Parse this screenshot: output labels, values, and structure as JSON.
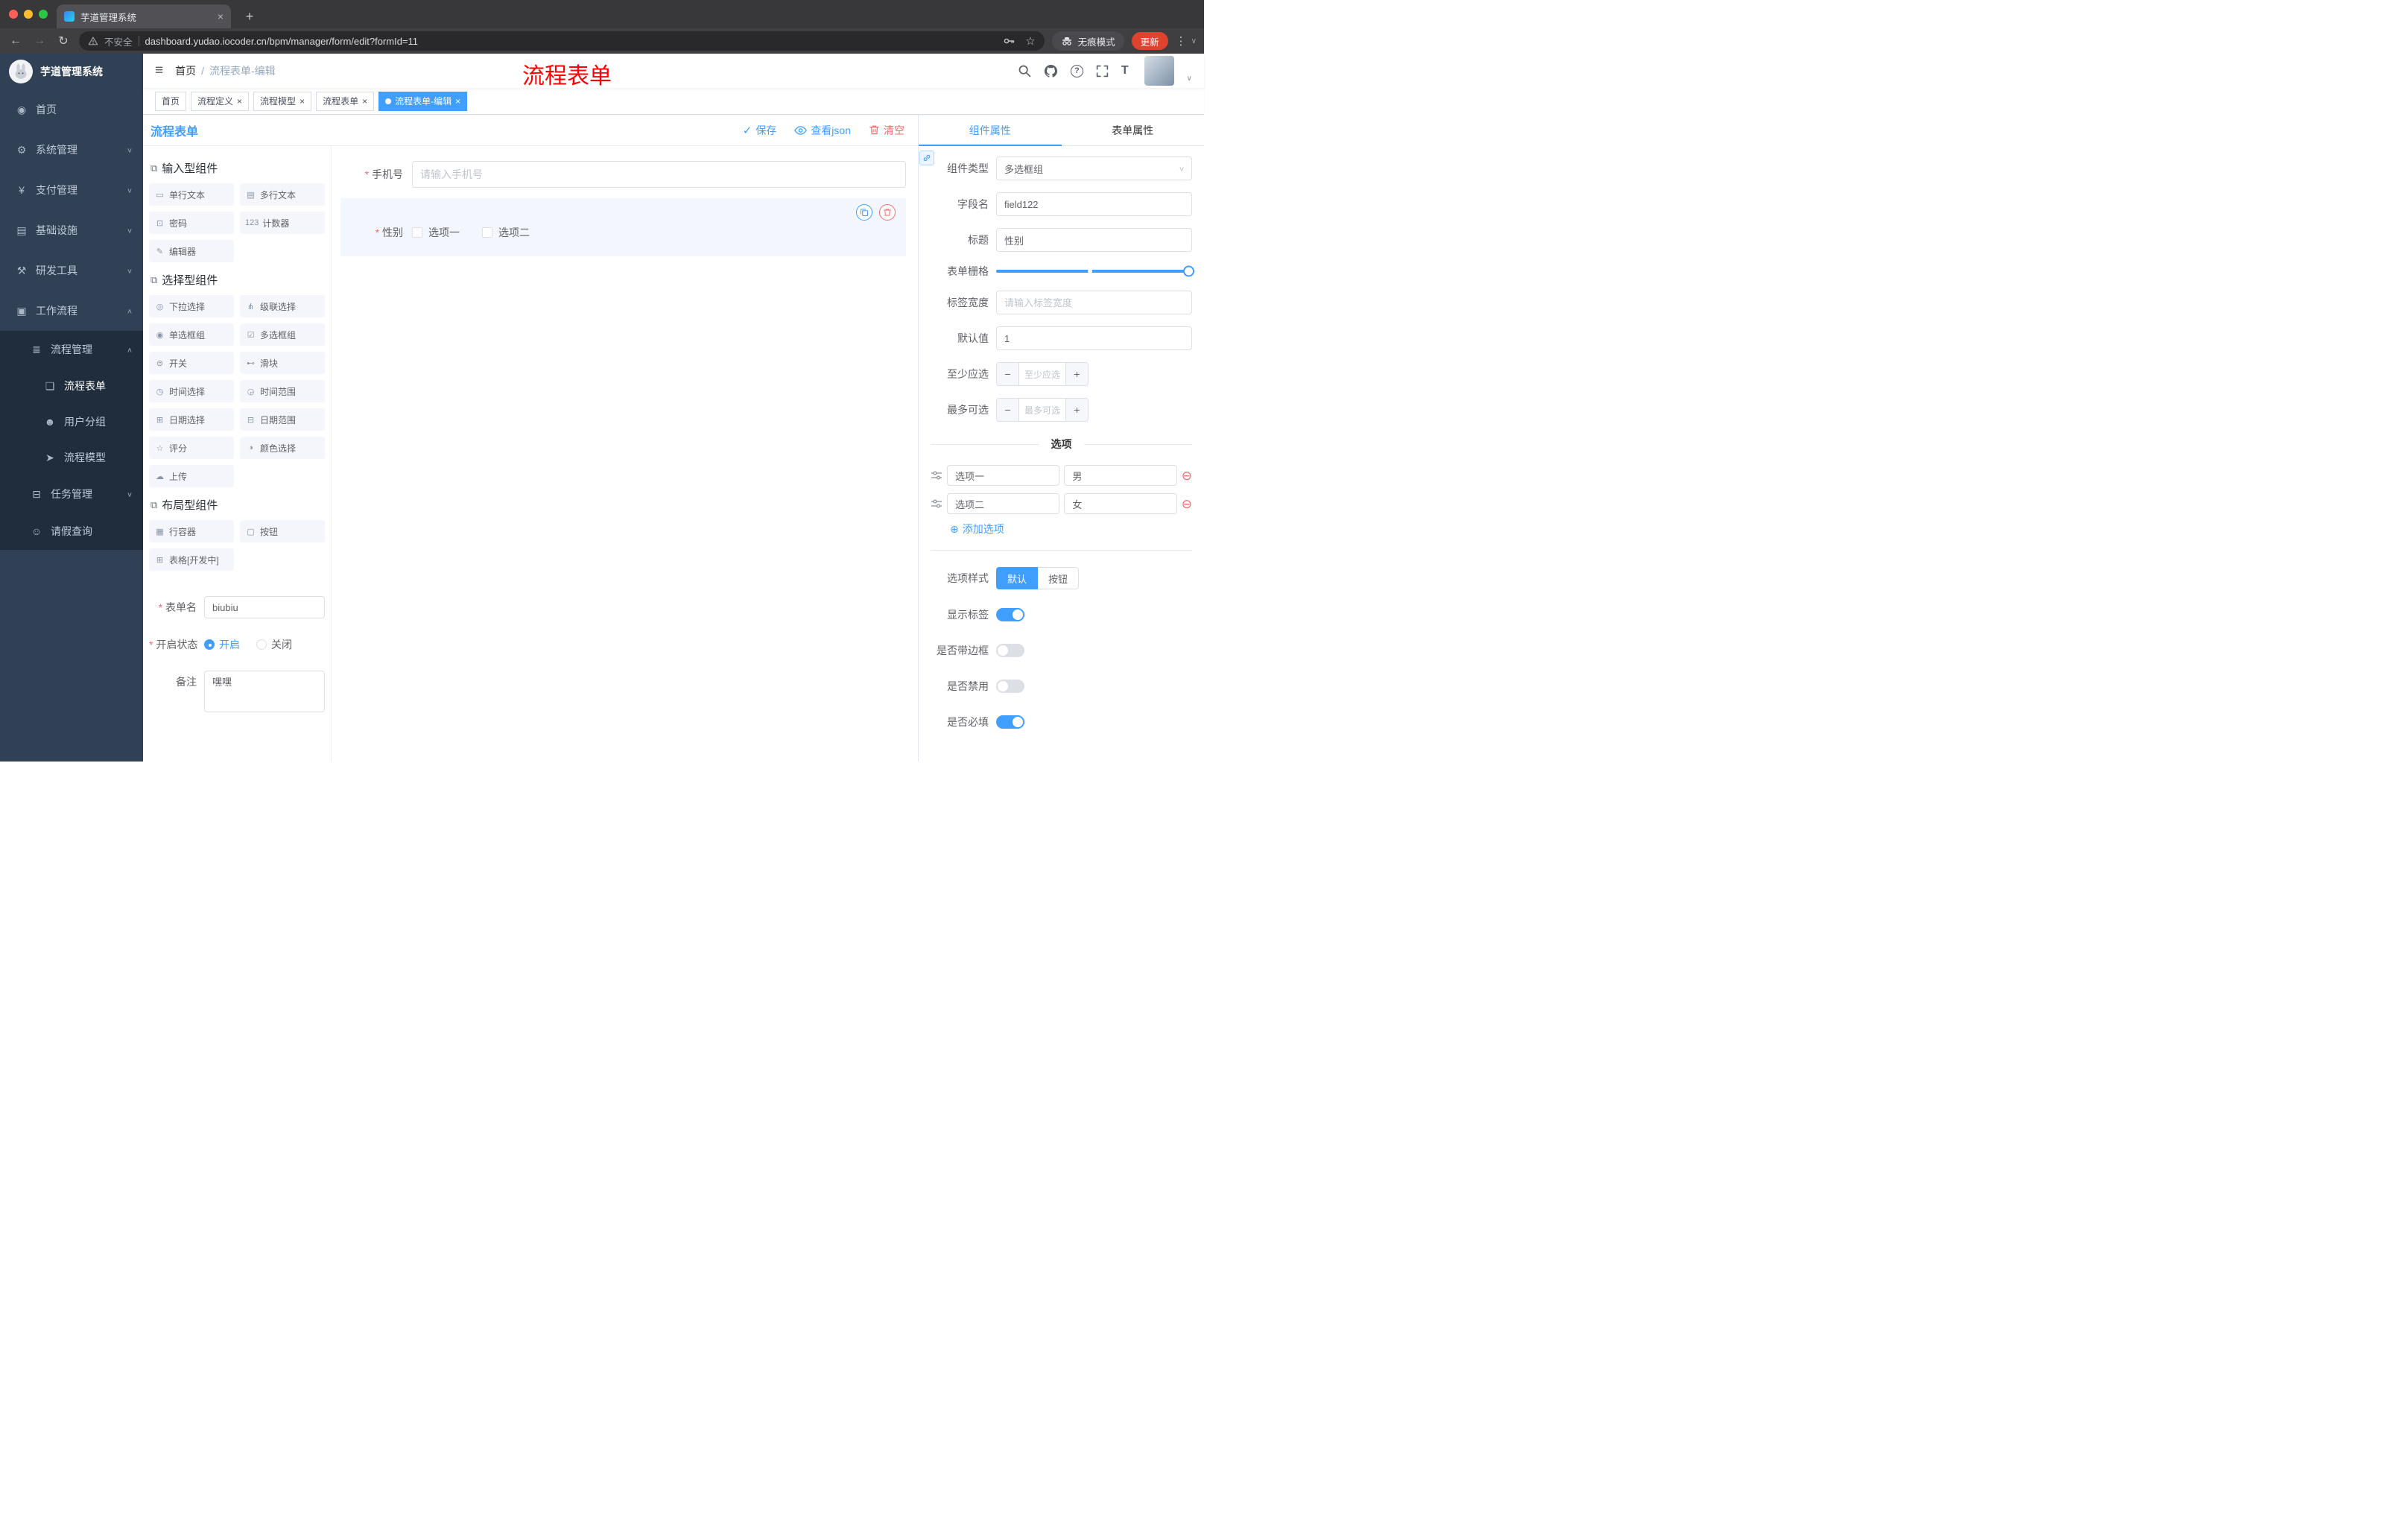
{
  "colors": {
    "accent": "#409EFF",
    "danger": "#F56C6C",
    "sidebar_bg": "#304156",
    "submenu_bg": "#1F2D3D",
    "annotation_red": "#FF0000",
    "active_tag_bg": "#409EFF",
    "update_pill_bg": "#E0432D"
  },
  "icons": {
    "back": "←",
    "forward": "→",
    "reload": "↻",
    "more": "⋮",
    "star": "☆",
    "plus": "+",
    "close": "×",
    "hamburger": "≡",
    "check": "✓",
    "caret_down": "∨",
    "caret_up": "∧",
    "question": "?",
    "font_size": "T",
    "group_cube": "⧉",
    "add_circle": "⊕",
    "remove_circle": "⊖",
    "minus": "−"
  },
  "browser": {
    "tab_title": "芋道管理系统",
    "security_label": "不安全",
    "url": "dashboard.yudao.iocoder.cn/bpm/manager/form/edit?formId=11",
    "incognito_label": "无痕模式",
    "update_label": "更新"
  },
  "navbar": {
    "breadcrumb_home": "首页",
    "breadcrumb_sep": "/",
    "breadcrumb_current": "流程表单-编辑",
    "annotation": "流程表单"
  },
  "tags_view": [
    {
      "label": "首页"
    },
    {
      "label": "流程定义"
    },
    {
      "label": "流程模型"
    },
    {
      "label": "流程表单"
    },
    {
      "label": "流程表单-编辑"
    }
  ],
  "sidebar": {
    "logo_title": "芋道管理系统",
    "items": [
      {
        "icon": "◉",
        "label": "首页"
      },
      {
        "icon": "⚙",
        "label": "系统管理"
      },
      {
        "icon": "¥",
        "label": "支付管理"
      },
      {
        "icon": "▤",
        "label": "基础设施"
      },
      {
        "icon": "⚒",
        "label": "研发工具"
      },
      {
        "icon": "▣",
        "label": "工作流程"
      },
      {
        "icon": "≣",
        "label": "流程管理"
      },
      {
        "icon": "❏",
        "label": "流程表单"
      },
      {
        "icon": "☻",
        "label": "用户分组"
      },
      {
        "icon": "➤",
        "label": "流程模型"
      },
      {
        "icon": "⊟",
        "label": "任务管理"
      },
      {
        "icon": "☺",
        "label": "请假查询"
      }
    ]
  },
  "designer": {
    "title": "流程表单",
    "actions": {
      "save": "保存",
      "view_json": "查看json",
      "clear": "清空"
    },
    "palette": {
      "groups": [
        {
          "title": "输入型组件",
          "items": [
            {
              "icon": "▭",
              "label": "单行文本"
            },
            {
              "icon": "▤",
              "label": "多行文本"
            },
            {
              "icon": "⊡",
              "label": "密码"
            },
            {
              "icon": "123",
              "label": "计数器"
            },
            {
              "icon": "✎",
              "label": "编辑器"
            }
          ]
        },
        {
          "title": "选择型组件",
          "items": [
            {
              "icon": "◎",
              "label": "下拉选择"
            },
            {
              "icon": "⋔",
              "label": "级联选择"
            },
            {
              "icon": "◉",
              "label": "单选框组"
            },
            {
              "icon": "☑",
              "label": "多选框组"
            },
            {
              "icon": "⊜",
              "label": "开关"
            },
            {
              "icon": "⊷",
              "label": "滑块"
            },
            {
              "icon": "◷",
              "label": "时间选择"
            },
            {
              "icon": "◶",
              "label": "时间范围"
            },
            {
              "icon": "⊞",
              "label": "日期选择"
            },
            {
              "icon": "⊟",
              "label": "日期范围"
            },
            {
              "icon": "☆",
              "label": "评分"
            },
            {
              "icon": "◑",
              "label": "颜色选择"
            },
            {
              "icon": "☁",
              "label": "上传"
            }
          ]
        },
        {
          "title": "布局型组件",
          "items": [
            {
              "icon": "▦",
              "label": "行容器"
            },
            {
              "icon": "▢",
              "label": "按钮"
            },
            {
              "icon": "⊞",
              "label": "表格[开发中]"
            }
          ]
        }
      ]
    },
    "meta": {
      "name_label": "表单名",
      "name_value": "biubiu",
      "status_label": "开启状态",
      "status_on": "开启",
      "status_off": "关闭",
      "remark_label": "备注",
      "remark_value": "嘿嘿"
    },
    "canvas": {
      "phone": {
        "label": "手机号",
        "placeholder": "请输入手机号"
      },
      "gender": {
        "label": "性别",
        "option1": "选项一",
        "option2": "选项二"
      }
    }
  },
  "props": {
    "tab_component": "组件属性",
    "tab_form": "表单属性",
    "component_type": {
      "label": "组件类型",
      "value": "多选框组"
    },
    "field_name": {
      "label": "字段名",
      "value": "field122"
    },
    "title": {
      "label": "标题",
      "value": "性别"
    },
    "grid": {
      "label": "表单栅格"
    },
    "label_width": {
      "label": "标签宽度",
      "placeholder": "请输入标签宽度"
    },
    "default_value": {
      "label": "默认值",
      "value": "1"
    },
    "min_select": {
      "label": "至少应选",
      "placeholder": "至少应选"
    },
    "max_select": {
      "label": "最多可选",
      "placeholder": "最多可选"
    },
    "options": {
      "divider": "选项",
      "rows": [
        {
          "name": "选项一",
          "value": "男"
        },
        {
          "name": "选项二",
          "value": "女"
        }
      ],
      "add": "添加选项"
    },
    "style": {
      "label": "选项样式",
      "default": "默认",
      "button": "按钮"
    },
    "switches": [
      {
        "label": "显示标签",
        "on": true
      },
      {
        "label": "是否带边框",
        "on": false
      },
      {
        "label": "是否禁用",
        "on": false
      },
      {
        "label": "是否必填",
        "on": true
      }
    ]
  }
}
